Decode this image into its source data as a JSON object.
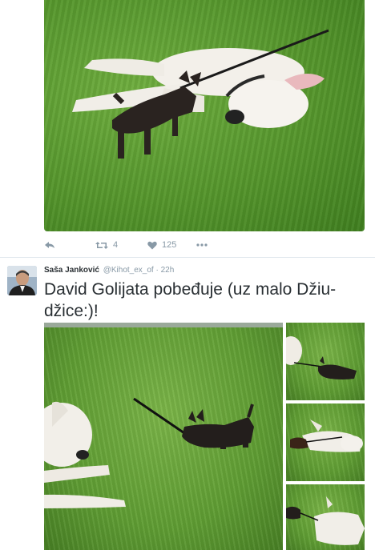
{
  "tweet1": {
    "actions": {
      "reply_icon": "reply-icon",
      "retweet_icon": "retweet-icon",
      "retweet_count": "4",
      "like_icon": "heart-icon",
      "like_count": "125",
      "more_icon": "more-dots-icon"
    }
  },
  "tweet2": {
    "author": {
      "name": "Saša Janković",
      "handle": "@Kihot_ex_of",
      "separator": "·",
      "time": "22h"
    },
    "text_line1": "David Golijata pobeđuje (uz malo Džiu-",
    "text_line2": "džice:)!"
  },
  "colors": {
    "text": "#292f33",
    "muted": "#8899a6",
    "divider": "#e1e8ed",
    "grass": "#5f9d33"
  }
}
